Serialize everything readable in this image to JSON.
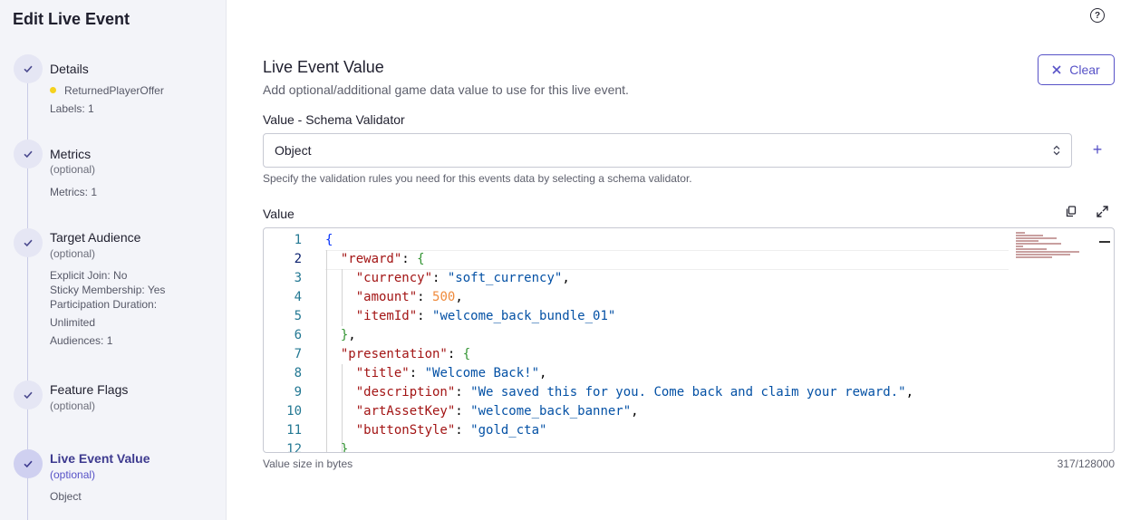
{
  "sidebar": {
    "title": "Edit Live Event",
    "steps": [
      {
        "title": "Details",
        "optional": "",
        "meta": [
          "ReturnedPlayerOffer",
          "Labels: 1"
        ]
      },
      {
        "title": "Metrics",
        "optional": "(optional)",
        "meta": [
          "Metrics: 1"
        ]
      },
      {
        "title": "Target Audience",
        "optional": "(optional)",
        "meta": [
          "Explicit Join: No",
          "Sticky Membership: Yes",
          "Participation Duration:",
          "Unlimited",
          "Audiences: 1"
        ]
      },
      {
        "title": "Feature Flags",
        "optional": "(optional)",
        "meta": []
      },
      {
        "title": "Live Event Value",
        "optional": "(optional)",
        "meta": [
          "Object"
        ]
      }
    ]
  },
  "main": {
    "help_icon": "?",
    "title": "Live Event Value",
    "description": "Add optional/additional game data value to use for this live event.",
    "clear_label": "Clear",
    "schema_label": "Value - Schema Validator",
    "schema_value": "Object",
    "add_icon": "+",
    "schema_helper": "Specify the validation rules you need for this events data by selecting a schema validator.",
    "value_label": "Value",
    "value_size_label": "Value size in bytes",
    "value_size": "317/128000"
  },
  "editor": {
    "line_numbers": [
      "1",
      "2",
      "3",
      "4",
      "5",
      "6",
      "7",
      "8",
      "9",
      "10",
      "11",
      "12"
    ],
    "lines": [
      "{",
      "  \"reward\": {",
      "    \"currency\": \"soft_currency\",",
      "    \"amount\": 500,",
      "    \"itemId\": \"welcome_back_bundle_01\"",
      "  },",
      "  \"presentation\": {",
      "    \"title\": \"Welcome Back!\",",
      "    \"description\": \"We saved this for you. Come back and claim your reward.\",",
      "    \"artAssetKey\": \"welcome_back_banner\",",
      "    \"buttonStyle\": \"gold_cta\"",
      "  }"
    ]
  },
  "colors": {
    "accent": "#5752c7",
    "sidebar_bg": "#f3f4f9",
    "label_dot": "#f5d21f",
    "json_key": "#a31515",
    "json_string": "#0451a5",
    "json_number": "#ef8a3c"
  },
  "icons": {
    "step_done": "check-icon",
    "help": "help-circle-icon",
    "clear": "close-icon",
    "select": "chevron-up-down-icon",
    "add": "plus-icon",
    "copy": "copy-icon",
    "expand": "expand-icon"
  }
}
